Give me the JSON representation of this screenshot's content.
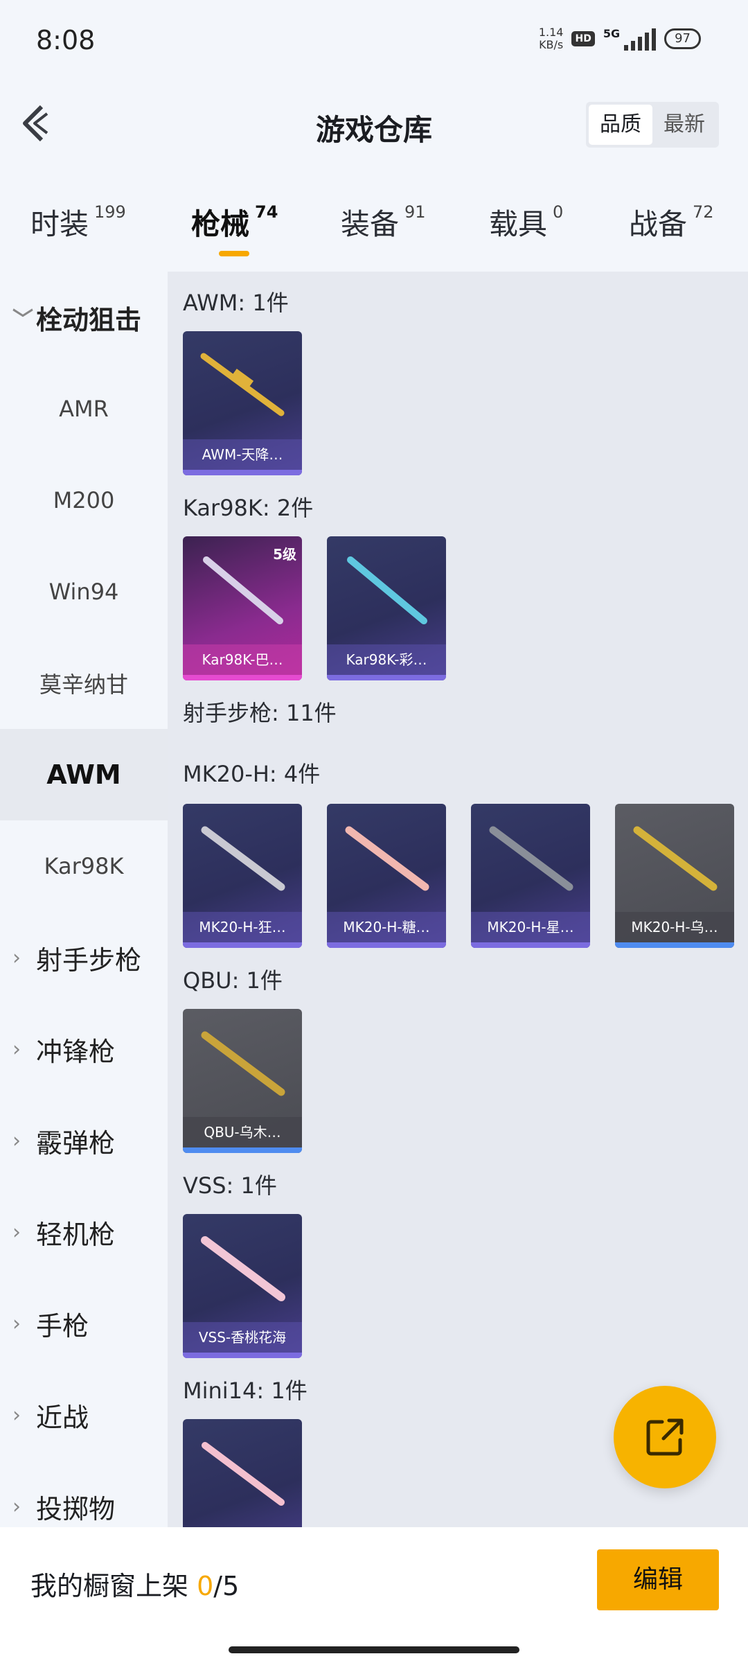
{
  "status_bar": {
    "time": "8:08",
    "net_speed_value": "1.14",
    "net_speed_unit": "KB/s",
    "hd": "HD",
    "network": "5G",
    "battery": "97"
  },
  "header": {
    "title": "游戏仓库",
    "sort_options": [
      "品质",
      "最新"
    ],
    "active_sort": "品质"
  },
  "tabs": [
    {
      "label": "时装",
      "count": "199"
    },
    {
      "label": "枪械",
      "count": "74",
      "active": true
    },
    {
      "label": "装备",
      "count": "91"
    },
    {
      "label": "载具",
      "count": "0"
    },
    {
      "label": "战备",
      "count": "72"
    }
  ],
  "sidebar": {
    "items": [
      {
        "label": "栓动狙击",
        "type": "group",
        "expanded": true
      },
      {
        "label": "AMR"
      },
      {
        "label": "M200"
      },
      {
        "label": "Win94"
      },
      {
        "label": "莫辛纳甘"
      },
      {
        "label": "AWM",
        "selected": true
      },
      {
        "label": "Kar98K"
      },
      {
        "label": "射手步枪",
        "type": "group"
      },
      {
        "label": "冲锋枪",
        "type": "group"
      },
      {
        "label": "霰弹枪",
        "type": "group"
      },
      {
        "label": "轻机枪",
        "type": "group"
      },
      {
        "label": "手枪",
        "type": "group"
      },
      {
        "label": "近战",
        "type": "group"
      },
      {
        "label": "投掷物",
        "type": "group"
      }
    ]
  },
  "content": {
    "sections": [
      {
        "title": "AWM: 1件",
        "items": [
          {
            "name": "AWM-天降…",
            "rarity": "purple",
            "gun_color": "#e0b23a"
          }
        ]
      },
      {
        "title": "Kar98K: 2件",
        "items": [
          {
            "name": "Kar98K-巴…",
            "rarity": "pink",
            "level": "5级",
            "gun_color": "#d8d0e8"
          },
          {
            "name": "Kar98K-彩…",
            "rarity": "purple",
            "gun_color": "#5fc8e0"
          }
        ]
      },
      {
        "title": "射手步枪: 11件",
        "items": []
      },
      {
        "title": "MK20-H: 4件",
        "items": [
          {
            "name": "MK20-H-狂…",
            "rarity": "purple",
            "gun_color": "#c9c9d2"
          },
          {
            "name": "MK20-H-糖…",
            "rarity": "purple",
            "gun_color": "#f1b7b0"
          },
          {
            "name": "MK20-H-星…",
            "rarity": "purple",
            "gun_color": "#8a8f99"
          },
          {
            "name": "MK20-H-乌…",
            "rarity": "grey",
            "gun_color": "#d4b23a"
          }
        ]
      },
      {
        "title": "QBU: 1件",
        "items": [
          {
            "name": "QBU-乌木…",
            "rarity": "grey",
            "gun_color": "#c9a43a"
          }
        ]
      },
      {
        "title": "VSS: 1件",
        "items": [
          {
            "name": "VSS-香桃花海",
            "rarity": "purple",
            "gun_color": "#f2c6d6"
          }
        ]
      },
      {
        "title": "Mini14: 1件",
        "items": [
          {
            "name": "",
            "rarity": "purple",
            "gun_color": "#f4c0cf"
          }
        ]
      }
    ]
  },
  "bottom_bar": {
    "label": "我的橱窗上架",
    "current": "0",
    "total": "/5",
    "edit_label": "编辑"
  },
  "colors": {
    "accent": "#f7a800",
    "purple_card": "#343a66",
    "pink_card": "#8a2b8f",
    "grey_card": "#4a4b52"
  },
  "icons": {
    "back": "chevron-left-icon",
    "fab": "share-external-icon",
    "expand": "chevron-right-icon",
    "collapse": "chevron-down-icon"
  }
}
